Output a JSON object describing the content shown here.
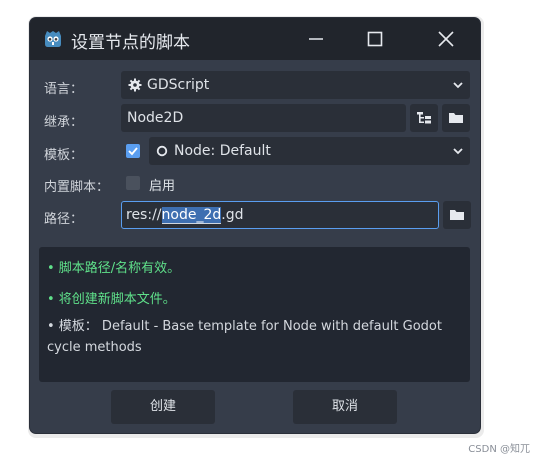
{
  "window": {
    "title": "设置节点的脚本",
    "minimize_label": "minimize",
    "maximize_label": "maximize",
    "close_label": "close"
  },
  "form": {
    "language": {
      "label": "语言：",
      "value": "GDScript"
    },
    "inherits": {
      "label": "继承：",
      "value": "Node2D"
    },
    "template": {
      "label": "模板：",
      "checked": true,
      "value": "Node: Default"
    },
    "builtin": {
      "label": "内置脚本：",
      "checkbox_label": "启用",
      "checked": false
    },
    "path": {
      "label": "路径：",
      "prefix": "res://",
      "selected": "node_2d",
      "suffix": ".gd"
    }
  },
  "messages": {
    "path_valid": "• 脚本路径/名称有效。",
    "will_create": "• 将创建新脚本文件。",
    "template_info": "• 模板： Default - Base template for Node with default Godot cycle methods"
  },
  "buttons": {
    "create": "创建",
    "cancel": "取消"
  },
  "watermark": "CSDN @知兀",
  "colors": {
    "dialog_bg": "#363d4a",
    "titlebar_bg": "#21252c",
    "field_bg": "#2a2f38",
    "info_bg": "#222731",
    "ok_text": "#5fe08a",
    "accent": "#5a9ef0",
    "godot_blue": "#478cbf"
  },
  "icons": {
    "app": "godot-icon",
    "language": "gear-icon",
    "inherits_tree": "node-tree-icon",
    "folder": "folder-icon",
    "template": "circle-outline-icon",
    "dropdown": "chevron-down-icon"
  }
}
